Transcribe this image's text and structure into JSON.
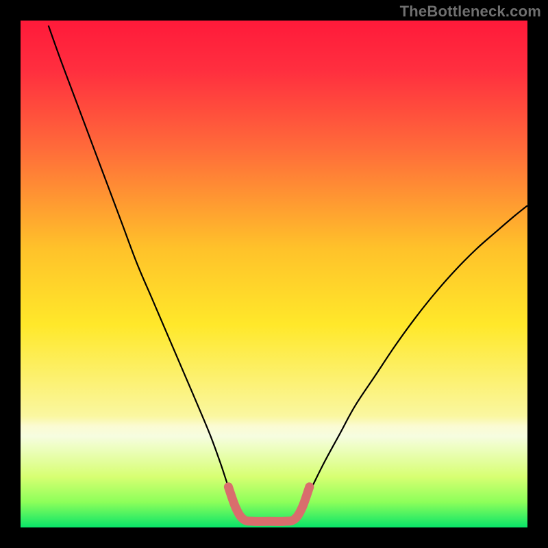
{
  "watermark": "TheBottleneck.com",
  "chart_data": {
    "type": "line",
    "title": "",
    "xlabel": "",
    "ylabel": "",
    "xlim": [
      0,
      100
    ],
    "ylim": [
      0,
      100
    ],
    "background_gradient": {
      "stops": [
        {
          "offset": 0.0,
          "color": "#ff1a3a"
        },
        {
          "offset": 0.1,
          "color": "#ff2f3f"
        },
        {
          "offset": 0.25,
          "color": "#ff6a3a"
        },
        {
          "offset": 0.45,
          "color": "#ffc22a"
        },
        {
          "offset": 0.6,
          "color": "#ffe82a"
        },
        {
          "offset": 0.78,
          "color": "#faf7a0"
        },
        {
          "offset": 0.8,
          "color": "#fbfbd2"
        },
        {
          "offset": 0.82,
          "color": "#f6fde0"
        },
        {
          "offset": 0.9,
          "color": "#d7ff72"
        },
        {
          "offset": 0.95,
          "color": "#8dff5a"
        },
        {
          "offset": 1.0,
          "color": "#08e469"
        }
      ]
    },
    "series": [
      {
        "name": "curve-left",
        "stroke": "#000000",
        "stroke_width": 2.2,
        "points": [
          {
            "x": 5.5,
            "y": 99.0
          },
          {
            "x": 8.0,
            "y": 92.0
          },
          {
            "x": 11.0,
            "y": 84.0
          },
          {
            "x": 14.0,
            "y": 76.0
          },
          {
            "x": 17.0,
            "y": 68.0
          },
          {
            "x": 20.0,
            "y": 60.0
          },
          {
            "x": 23.0,
            "y": 52.0
          },
          {
            "x": 26.0,
            "y": 45.0
          },
          {
            "x": 29.0,
            "y": 38.0
          },
          {
            "x": 32.0,
            "y": 31.0
          },
          {
            "x": 35.0,
            "y": 24.0
          },
          {
            "x": 37.5,
            "y": 18.0
          },
          {
            "x": 39.5,
            "y": 12.5
          },
          {
            "x": 41.0,
            "y": 8.0
          },
          {
            "x": 42.5,
            "y": 4.0
          },
          {
            "x": 44.0,
            "y": 1.5
          }
        ]
      },
      {
        "name": "curve-right",
        "stroke": "#000000",
        "stroke_width": 2.2,
        "points": [
          {
            "x": 54.0,
            "y": 1.5
          },
          {
            "x": 55.5,
            "y": 4.0
          },
          {
            "x": 57.5,
            "y": 8.0
          },
          {
            "x": 60.0,
            "y": 13.0
          },
          {
            "x": 63.0,
            "y": 18.5
          },
          {
            "x": 66.0,
            "y": 24.0
          },
          {
            "x": 70.0,
            "y": 30.0
          },
          {
            "x": 74.0,
            "y": 36.0
          },
          {
            "x": 78.0,
            "y": 41.5
          },
          {
            "x": 82.0,
            "y": 46.5
          },
          {
            "x": 86.0,
            "y": 51.0
          },
          {
            "x": 90.0,
            "y": 55.0
          },
          {
            "x": 94.0,
            "y": 58.5
          },
          {
            "x": 97.5,
            "y": 61.5
          },
          {
            "x": 100.0,
            "y": 63.5
          }
        ]
      },
      {
        "name": "highlight-valley",
        "stroke": "#d96d6d",
        "stroke_width": 13,
        "linecap": "round",
        "points": [
          {
            "x": 41.0,
            "y": 8.0
          },
          {
            "x": 42.5,
            "y": 3.8
          },
          {
            "x": 44.0,
            "y": 1.6
          },
          {
            "x": 46.0,
            "y": 1.2
          },
          {
            "x": 49.0,
            "y": 1.2
          },
          {
            "x": 52.0,
            "y": 1.2
          },
          {
            "x": 54.0,
            "y": 1.6
          },
          {
            "x": 55.5,
            "y": 3.8
          },
          {
            "x": 57.0,
            "y": 8.0
          }
        ]
      }
    ]
  }
}
